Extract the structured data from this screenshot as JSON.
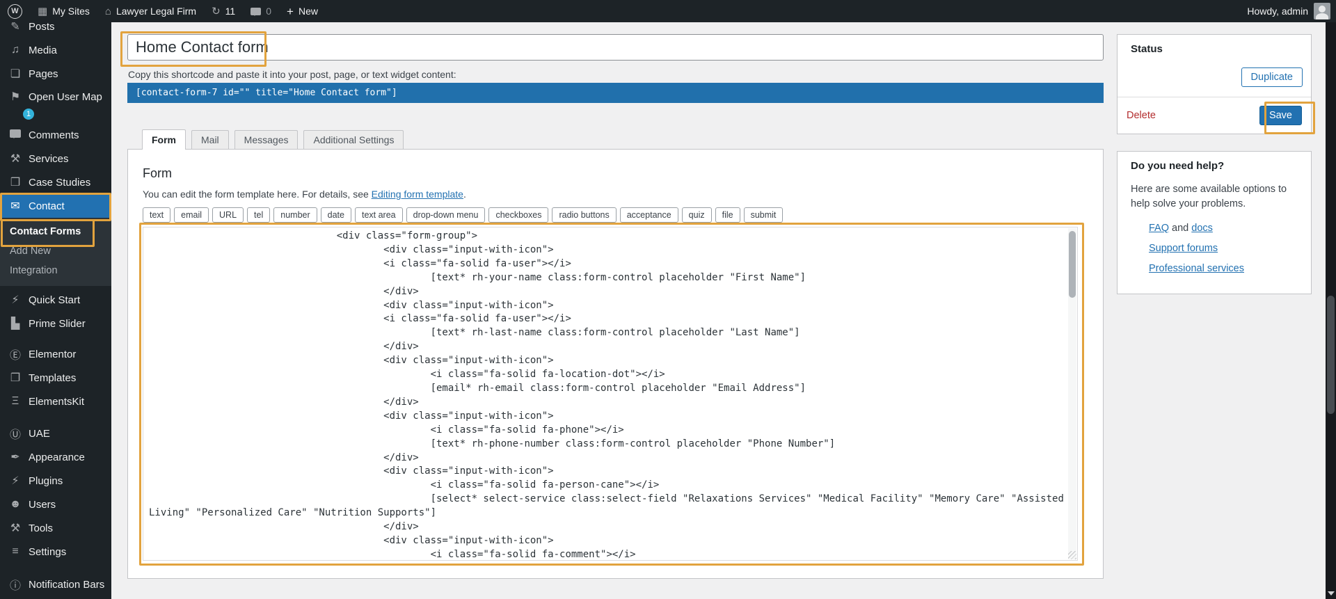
{
  "annotation_color": "#e2a33e",
  "admin_bar": {
    "wp_logo": "W",
    "my_sites": "My Sites",
    "site_name": "Lawyer Legal Firm",
    "update_count": "11",
    "comment_count": "0",
    "new_label": "New",
    "howdy": "Howdy, admin"
  },
  "sidebar": {
    "items": [
      {
        "type": "item",
        "name": "posts",
        "label": "Posts",
        "icon": "pushpin",
        "glyph": "✎"
      },
      {
        "type": "item",
        "name": "media",
        "label": "Media",
        "icon": "media",
        "glyph": "♫"
      },
      {
        "type": "item",
        "name": "pages",
        "label": "Pages",
        "icon": "pages",
        "glyph": "❏"
      },
      {
        "type": "item",
        "name": "open-user-map",
        "label": "Open User Map",
        "icon": "map-flag",
        "glyph": "⚑",
        "badge": "1"
      },
      {
        "type": "item",
        "name": "comments",
        "label": "Comments",
        "icon": "comment-bubble",
        "glyph": "BUBBLE"
      },
      {
        "type": "item",
        "name": "services",
        "label": "Services",
        "icon": "wrench",
        "glyph": "⚒"
      },
      {
        "type": "item",
        "name": "case-studies",
        "label": "Case Studies",
        "icon": "folder",
        "glyph": "❒"
      },
      {
        "type": "item",
        "name": "contact",
        "label": "Contact",
        "icon": "envelope",
        "glyph": "✉",
        "active": true
      },
      {
        "type": "submenu",
        "items": [
          {
            "name": "contact-forms",
            "label": "Contact Forms",
            "current": true
          },
          {
            "name": "add-new",
            "label": "Add New"
          },
          {
            "name": "integration",
            "label": "Integration"
          }
        ]
      },
      {
        "type": "gap",
        "h": 3
      },
      {
        "type": "item",
        "name": "quick-start",
        "label": "Quick Start",
        "icon": "plug",
        "glyph": "⚡"
      },
      {
        "type": "item",
        "name": "prime-slider",
        "label": "Prime Slider",
        "icon": "prime-slider-logo",
        "glyph": "▙"
      },
      {
        "type": "gap",
        "h": 10
      },
      {
        "type": "item",
        "name": "elementor",
        "label": "Elementor",
        "icon": "elementor-logo",
        "glyph": "Ⓔ"
      },
      {
        "type": "item",
        "name": "templates",
        "label": "Templates",
        "icon": "folder-open",
        "glyph": "❐"
      },
      {
        "type": "item",
        "name": "elementskit",
        "label": "ElementsKit",
        "icon": "elementskit-logo",
        "glyph": "Ξ"
      },
      {
        "type": "gap",
        "h": 12
      },
      {
        "type": "item",
        "name": "uae",
        "label": "UAE",
        "icon": "uae-logo",
        "glyph": "Ⓤ"
      },
      {
        "type": "item",
        "name": "appearance",
        "label": "Appearance",
        "icon": "brush",
        "glyph": "✒"
      },
      {
        "type": "item",
        "name": "plugins",
        "label": "Plugins",
        "icon": "plugin",
        "glyph": "⚡"
      },
      {
        "type": "item",
        "name": "users",
        "label": "Users",
        "icon": "person",
        "glyph": "☻"
      },
      {
        "type": "item",
        "name": "tools",
        "label": "Tools",
        "icon": "tools-wrench",
        "glyph": "⚒"
      },
      {
        "type": "item",
        "name": "settings",
        "label": "Settings",
        "icon": "sliders",
        "glyph": "≡"
      },
      {
        "type": "gap",
        "h": 13
      },
      {
        "type": "item",
        "name": "notification-bars",
        "label": "Notification Bars",
        "icon": "info-circle",
        "glyph": "ⓘ"
      }
    ]
  },
  "editor": {
    "title_value": "Home Contact form",
    "shortcode_hint": "Copy this shortcode and paste it into your post, page, or text widget content:",
    "shortcode": "[contact-form-7 id=\"\" title=\"Home Contact form\"]"
  },
  "tabs": {
    "active_index": 0,
    "items": [
      {
        "name": "form",
        "label": "Form"
      },
      {
        "name": "mail",
        "label": "Mail"
      },
      {
        "name": "messages",
        "label": "Messages"
      },
      {
        "name": "additional-settings",
        "label": "Additional Settings"
      }
    ]
  },
  "form_panel": {
    "heading": "Form",
    "helper_prefix": "You can edit the form template here. For details, see ",
    "helper_link": "Editing form template",
    "helper_suffix": ".",
    "tag_buttons": [
      "text",
      "email",
      "URL",
      "tel",
      "number",
      "date",
      "text area",
      "drop-down menu",
      "checkboxes",
      "radio buttons",
      "acceptance",
      "quiz",
      "file",
      "submit"
    ],
    "code_lines": [
      "                                <div class=\"form-group\">",
      "                                        <div class=\"input-with-icon\">",
      "                                        <i class=\"fa-solid fa-user\"></i>",
      "                                                [text* rh-your-name class:form-control placeholder \"First Name\"]",
      "                                        </div>",
      "                                        <div class=\"input-with-icon\">",
      "                                        <i class=\"fa-solid fa-user\"></i>",
      "                                                [text* rh-last-name class:form-control placeholder \"Last Name\"]",
      "                                        </div>",
      "                                        <div class=\"input-with-icon\">",
      "                                                <i class=\"fa-solid fa-location-dot\"></i>",
      "                                                [email* rh-email class:form-control placeholder \"Email Address\"]",
      "                                        </div>",
      "                                        <div class=\"input-with-icon\">",
      "                                                <i class=\"fa-solid fa-phone\"></i>",
      "                                                [text* rh-phone-number class:form-control placeholder \"Phone Number\"]",
      "                                        </div>",
      "                                        <div class=\"input-with-icon\">",
      "                                                <i class=\"fa-solid fa-person-cane\"></i>",
      "                                                [select* select-service class:select-field \"Relaxations Services\" \"Medical Facility\" \"Memory Care\" \"Assisted",
      "Living\" \"Personalized Care\" \"Nutrition Supports\"]",
      "                                        </div>",
      "                                        <div class=\"input-with-icon\">",
      "                                                <i class=\"fa-solid fa-comment\"></i>"
    ]
  },
  "status": {
    "title": "Status",
    "duplicate": "Duplicate",
    "delete": "Delete",
    "save": "Save"
  },
  "help": {
    "title": "Do you need help?",
    "intro": "Here are some available options to help solve your problems.",
    "faq": "FAQ",
    "and": " and ",
    "docs": "docs",
    "support": "Support forums",
    "professional": "Professional services"
  }
}
